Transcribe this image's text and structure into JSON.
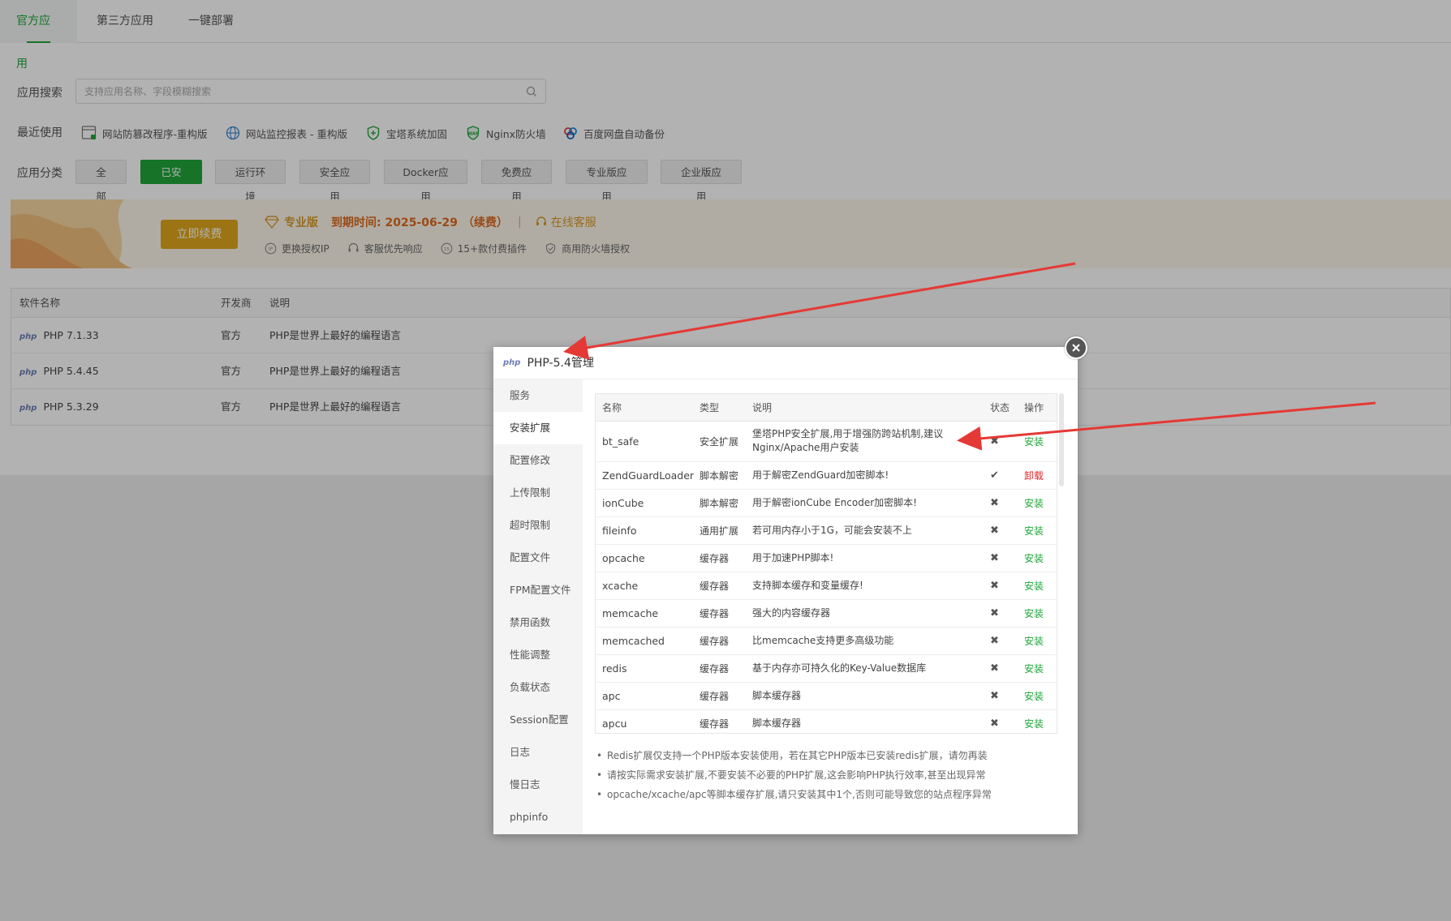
{
  "tabs": [
    {
      "label": "官方应用",
      "active": true
    },
    {
      "label": "第三方应用",
      "active": false
    },
    {
      "label": "一键部署",
      "active": false
    }
  ],
  "search": {
    "label": "应用搜索",
    "placeholder": "支持应用名称、字段模糊搜索",
    "icon": "search-icon"
  },
  "recent": {
    "label": "最近使用",
    "items": [
      {
        "label": "网站防篡改程序-重构版",
        "icon": "tamper-proof-icon"
      },
      {
        "label": "网站监控报表 - 重构版",
        "icon": "globe-monitor-icon"
      },
      {
        "label": "宝塔系统加固",
        "icon": "shield-icon"
      },
      {
        "label": "Nginx防火墙",
        "icon": "waf-shield-icon"
      },
      {
        "label": "百度网盘自动备份",
        "icon": "baidu-cloud-icon"
      }
    ]
  },
  "category": {
    "label": "应用分类",
    "items": [
      {
        "label": "全部",
        "active": false
      },
      {
        "label": "已安装",
        "active": true
      },
      {
        "label": "运行环境",
        "active": false
      },
      {
        "label": "安全应用",
        "active": false
      },
      {
        "label": "Docker应用",
        "active": false
      },
      {
        "label": "免费应用",
        "active": false
      },
      {
        "label": "专业版应用",
        "active": false
      },
      {
        "label": "企业版应用",
        "active": false
      }
    ]
  },
  "promo": {
    "renew_label": "立即续费",
    "edition": "专业版",
    "expire_text": "到期时间: 2025-06-29",
    "renew_link": "（续费）",
    "separator": "|",
    "service": "在线客服",
    "features": [
      "更换授权IP",
      "客服优先响应",
      "15+款付费插件",
      "商用防火墙授权"
    ]
  },
  "software_table": {
    "headers": [
      "软件名称",
      "开发商",
      "说明"
    ],
    "rows": [
      {
        "logo": "php",
        "name": "PHP 7.1.33",
        "dev": "官方",
        "desc": "PHP是世界上最好的编程语言"
      },
      {
        "logo": "php",
        "name": "PHP 5.4.45",
        "dev": "官方",
        "desc": "PHP是世界上最好的编程语言"
      },
      {
        "logo": "php",
        "name": "PHP 5.3.29",
        "dev": "官方",
        "desc": "PHP是世界上最好的编程语言"
      }
    ]
  },
  "modal": {
    "logo": "php",
    "title": "PHP-5.4管理",
    "nav": [
      {
        "label": "服务",
        "active": false
      },
      {
        "label": "安装扩展",
        "active": true
      },
      {
        "label": "配置修改",
        "active": false
      },
      {
        "label": "上传限制",
        "active": false
      },
      {
        "label": "超时限制",
        "active": false
      },
      {
        "label": "配置文件",
        "active": false
      },
      {
        "label": "FPM配置文件",
        "active": false
      },
      {
        "label": "禁用函数",
        "active": false
      },
      {
        "label": "性能调整",
        "active": false
      },
      {
        "label": "负载状态",
        "active": false
      },
      {
        "label": "Session配置",
        "active": false
      },
      {
        "label": "日志",
        "active": false
      },
      {
        "label": "慢日志",
        "active": false
      },
      {
        "label": "phpinfo",
        "active": false
      }
    ],
    "ext_headers": [
      "名称",
      "类型",
      "说明",
      "状态",
      "操作"
    ],
    "extensions": [
      {
        "name": "bt_safe",
        "type": "安全扩展",
        "desc": "堡塔PHP安全扩展,用于增强防跨站机制,建议Nginx/Apache用户安装",
        "installed": false,
        "op": "安装"
      },
      {
        "name": "ZendGuardLoader",
        "type": "脚本解密",
        "desc": "用于解密ZendGuard加密脚本!",
        "installed": true,
        "op": "卸载"
      },
      {
        "name": "ionCube",
        "type": "脚本解密",
        "desc": "用于解密ionCube Encoder加密脚本!",
        "installed": false,
        "op": "安装"
      },
      {
        "name": "fileinfo",
        "type": "通用扩展",
        "desc": "若可用内存小于1G，可能会安装不上",
        "installed": false,
        "op": "安装"
      },
      {
        "name": "opcache",
        "type": "缓存器",
        "desc": "用于加速PHP脚本!",
        "installed": false,
        "op": "安装"
      },
      {
        "name": "xcache",
        "type": "缓存器",
        "desc": "支持脚本缓存和变量缓存!",
        "installed": false,
        "op": "安装"
      },
      {
        "name": "memcache",
        "type": "缓存器",
        "desc": "强大的内容缓存器",
        "installed": false,
        "op": "安装"
      },
      {
        "name": "memcached",
        "type": "缓存器",
        "desc": "比memcache支持更多高级功能",
        "installed": false,
        "op": "安装"
      },
      {
        "name": "redis",
        "type": "缓存器",
        "desc": "基于内存亦可持久化的Key-Value数据库",
        "installed": false,
        "op": "安装"
      },
      {
        "name": "apc",
        "type": "缓存器",
        "desc": "脚本缓存器",
        "installed": false,
        "op": "安装"
      },
      {
        "name": "apcu",
        "type": "缓存器",
        "desc": "脚本缓存器",
        "installed": false,
        "op": "安装"
      }
    ],
    "tips": [
      "Redis扩展仅支持一个PHP版本安装使用，若在其它PHP版本已安装redis扩展，请勿再装",
      "请按实际需求安装扩展,不要安装不必要的PHP扩展,这会影响PHP执行效率,甚至出现异常",
      "opcache/xcache/apc等脚本缓存扩展,请只安装其中1个,否则可能导致您的站点程序异常"
    ]
  },
  "colors": {
    "accent": "#20a53a",
    "danger": "#e3262a",
    "gold": "#e0a71c",
    "arrow": "#e53935"
  }
}
